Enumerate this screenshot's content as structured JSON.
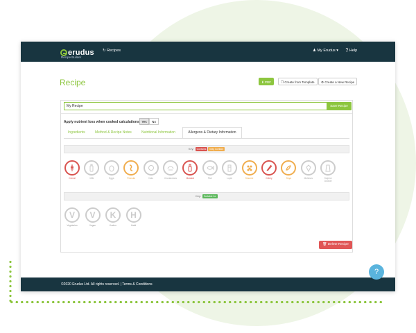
{
  "header": {
    "logo_text": "erudus",
    "logo_subtitle": "Recipe Builder",
    "nav_recipes": "Recipes",
    "user_menu": "My Erudus",
    "help": "Help"
  },
  "page": {
    "title": "Recipe",
    "buttons": {
      "pdf": "PDF",
      "create_from_template": "Create from Template",
      "create_new": "Create a New Recipe"
    }
  },
  "recipe": {
    "name_value": "My Recipe",
    "save_label": "Save Recipe",
    "nutrient_loss_label": "Apply nutrient loss when cooked calculations :",
    "yes_label": "Yes",
    "no_label": "No"
  },
  "tabs": [
    {
      "label": "Ingredients",
      "active": false
    },
    {
      "label": "Method & Recipe Notes",
      "active": false
    },
    {
      "label": "Nutritional Information",
      "active": false
    },
    {
      "label": "Allergens & Dietary Information",
      "active": true
    }
  ],
  "allergen_key": {
    "label": "Key:",
    "badges": [
      {
        "text": "Contains",
        "color": "#d9534f"
      },
      {
        "text": "May Contain",
        "color": "#f0ad4e"
      }
    ]
  },
  "allergens": [
    {
      "name": "Cereal",
      "state": "contains",
      "icon": "wheat-icon"
    },
    {
      "name": "Milk",
      "state": "none",
      "icon": "milk-icon"
    },
    {
      "name": "Eggs",
      "state": "none",
      "icon": "egg-icon"
    },
    {
      "name": "Peanuts",
      "state": "may",
      "icon": "peanut-icon"
    },
    {
      "name": "Nuts",
      "state": "none",
      "icon": "nut-icon"
    },
    {
      "name": "Crustaceans",
      "state": "none",
      "icon": "crustacean-icon"
    },
    {
      "name": "Mustard",
      "state": "contains",
      "icon": "mustard-icon"
    },
    {
      "name": "Fish",
      "state": "none",
      "icon": "fish-icon"
    },
    {
      "name": "Lupin",
      "state": "none",
      "icon": "lupin-icon"
    },
    {
      "name": "Sesame",
      "state": "may",
      "icon": "sesame-icon"
    },
    {
      "name": "Celery",
      "state": "contains",
      "icon": "celery-icon"
    },
    {
      "name": "Soya",
      "state": "may",
      "icon": "soya-icon"
    },
    {
      "name": "Molluscs",
      "state": "none",
      "icon": "mollusc-icon"
    },
    {
      "name": "Sulphur Dioxide",
      "state": "none",
      "icon": "sulphur-icon"
    }
  ],
  "dietary_key": {
    "label": "Key:",
    "badges": [
      {
        "text": "Suitable for",
        "color": "#5cb85c"
      }
    ]
  },
  "dietary": [
    {
      "name": "Vegetarian",
      "letter": "V"
    },
    {
      "name": "Vegan",
      "letter": "V"
    },
    {
      "name": "Kosher",
      "letter": "K"
    },
    {
      "name": "Halal",
      "letter": "H"
    }
  ],
  "actions": {
    "delete_label": "Delete Recipe"
  },
  "footer": {
    "text": "©2020 Erudus Ltd. All rights reserved. | Terms & Conditions"
  },
  "help_widget": {
    "label": "?"
  },
  "colors": {
    "brand_green": "#8dc63f",
    "header_navy": "#183540",
    "contains_red": "#d9534f",
    "may_contain_orange": "#f0ad4e",
    "inactive_grey": "#cccccc"
  }
}
